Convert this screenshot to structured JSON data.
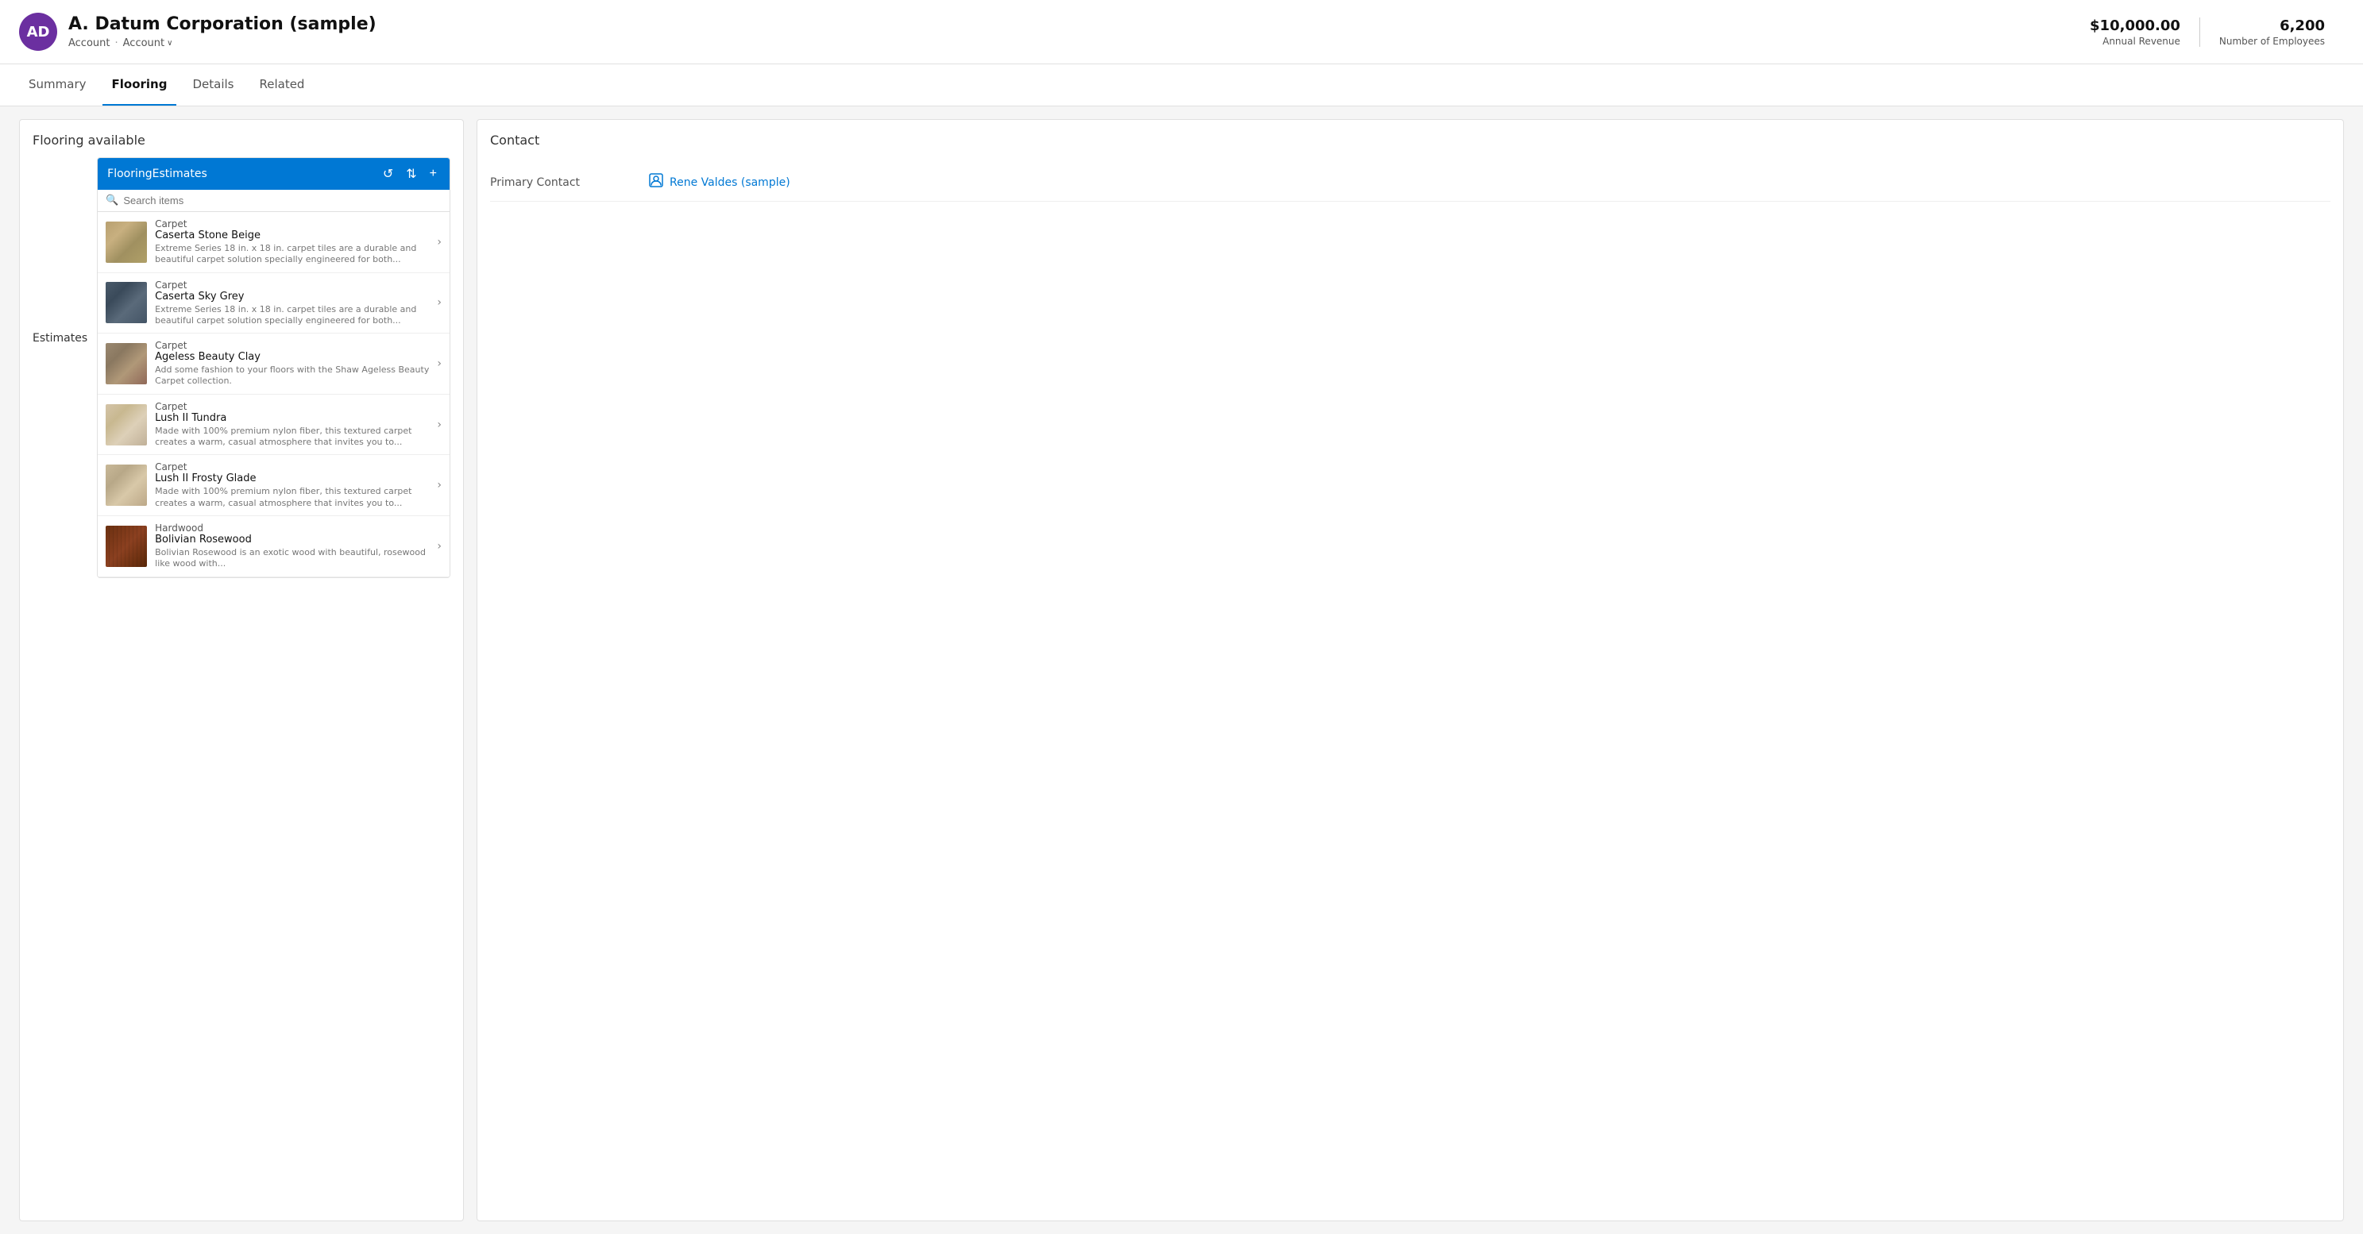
{
  "header": {
    "avatar_initials": "AD",
    "company_name": "A. Datum Corporation (sample)",
    "breadcrumb1": "Account",
    "breadcrumb2": "Account",
    "annual_revenue_label": "Annual Revenue",
    "annual_revenue_value": "$10,000.00",
    "employees_label": "Number of Employees",
    "employees_value": "6,200"
  },
  "nav": {
    "tabs": [
      {
        "id": "summary",
        "label": "Summary",
        "active": false
      },
      {
        "id": "flooring",
        "label": "Flooring",
        "active": true
      },
      {
        "id": "details",
        "label": "Details",
        "active": false
      },
      {
        "id": "related",
        "label": "Related",
        "active": false
      }
    ]
  },
  "left_panel": {
    "title": "Flooring available",
    "estimates_label": "Estimates",
    "widget": {
      "header_title": "FlooringEstimates",
      "search_placeholder": "Search items",
      "products": [
        {
          "type": "Carpet",
          "name": "Caserta Stone Beige",
          "desc": "Extreme Series 18 in. x 18 in. carpet tiles are a durable and beautiful carpet solution specially engineered for both...",
          "swatch_class": "swatch-caserta-beige"
        },
        {
          "type": "Carpet",
          "name": "Caserta Sky Grey",
          "desc": "Extreme Series 18 in. x 18 in. carpet tiles are a durable and beautiful carpet solution specially engineered for both...",
          "swatch_class": "swatch-caserta-grey"
        },
        {
          "type": "Carpet",
          "name": "Ageless Beauty Clay",
          "desc": "Add some fashion to your floors with the Shaw Ageless Beauty Carpet collection.",
          "swatch_class": "swatch-ageless-clay"
        },
        {
          "type": "Carpet",
          "name": "Lush II Tundra",
          "desc": "Made with 100% premium nylon fiber, this textured carpet creates a warm, casual atmosphere that invites you to...",
          "swatch_class": "swatch-lush-tundra"
        },
        {
          "type": "Carpet",
          "name": "Lush II Frosty Glade",
          "desc": "Made with 100% premium nylon fiber, this textured carpet creates a warm, casual atmosphere that invites you to...",
          "swatch_class": "swatch-lush-frosty"
        },
        {
          "type": "Hardwood",
          "name": "Bolivian Rosewood",
          "desc": "Bolivian Rosewood is an exotic wood with beautiful, rosewood like wood with...",
          "swatch_class": "swatch-hardwood"
        }
      ]
    }
  },
  "right_panel": {
    "title": "Contact",
    "primary_contact_label": "Primary Contact",
    "primary_contact_name": "Rene Valdes (sample)"
  },
  "icons": {
    "chevron_down": "⌄",
    "refresh": "↺",
    "sort": "⇅",
    "add": "+",
    "search": "🔍",
    "chevron_right": "›",
    "contact": "👤"
  }
}
